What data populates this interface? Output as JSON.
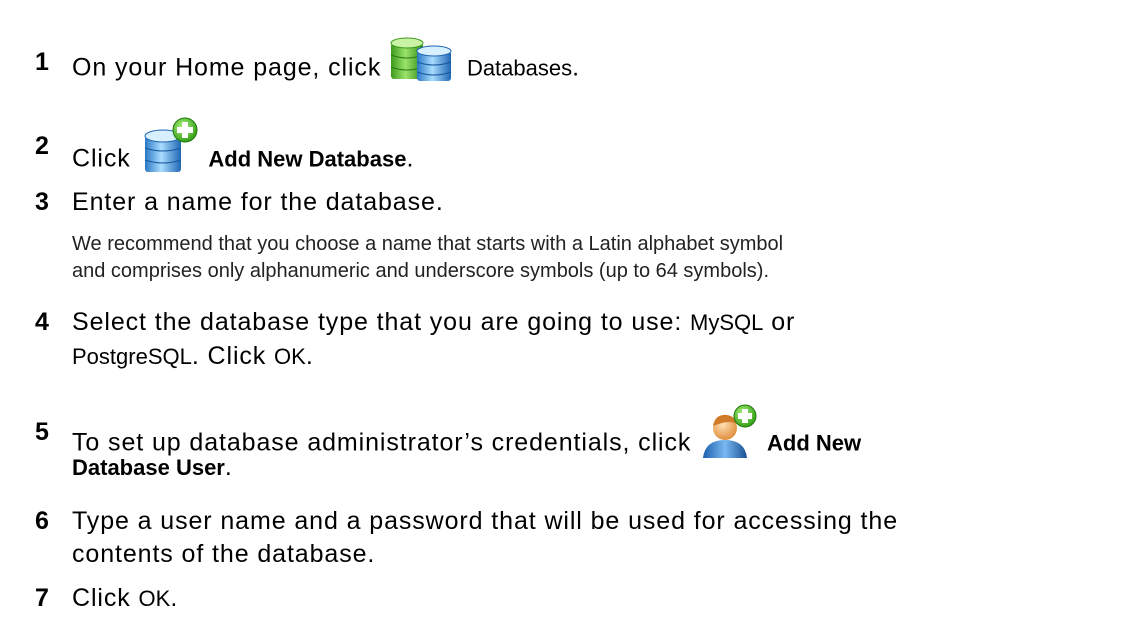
{
  "steps": [
    {
      "num": "1",
      "text_before": "On your Home page, click ",
      "ui_label": "Databases",
      "text_after": ".",
      "icon": "databases-icon"
    },
    {
      "num": "2",
      "text_before": "Click ",
      "ui_label": "Add New Database",
      "text_after": ".",
      "icon": "add-database-icon"
    },
    {
      "num": "3",
      "text": "Enter a name for the database.",
      "note": [
        "We recommend that you choose a name that starts with a Latin alphabet symbol",
        "and comprises only alphanumeric and underscore symbols (up to 64 symbols)."
      ]
    },
    {
      "num": "4",
      "line1_before": "Select the database type that you are going to use: ",
      "ui_mysql": "MySQL",
      "line1_after": " or",
      "ui_postgres": "PostgreSQL",
      "line2_after": ". Click ",
      "ui_ok": "OK",
      "line2_end": "."
    },
    {
      "num": "5",
      "text_before": "To set up database administrator’s credentials, click ",
      "ui_label_1": "Add New",
      "ui_label_2": "Database User",
      "text_after": ".",
      "icon": "add-user-icon"
    },
    {
      "num": "6",
      "line1": "Type a user name and a password that will be used for accessing the",
      "line2": "contents of the database."
    },
    {
      "num": "7",
      "text_before": "Click ",
      "ui_ok": "OK",
      "text_after": "."
    }
  ]
}
